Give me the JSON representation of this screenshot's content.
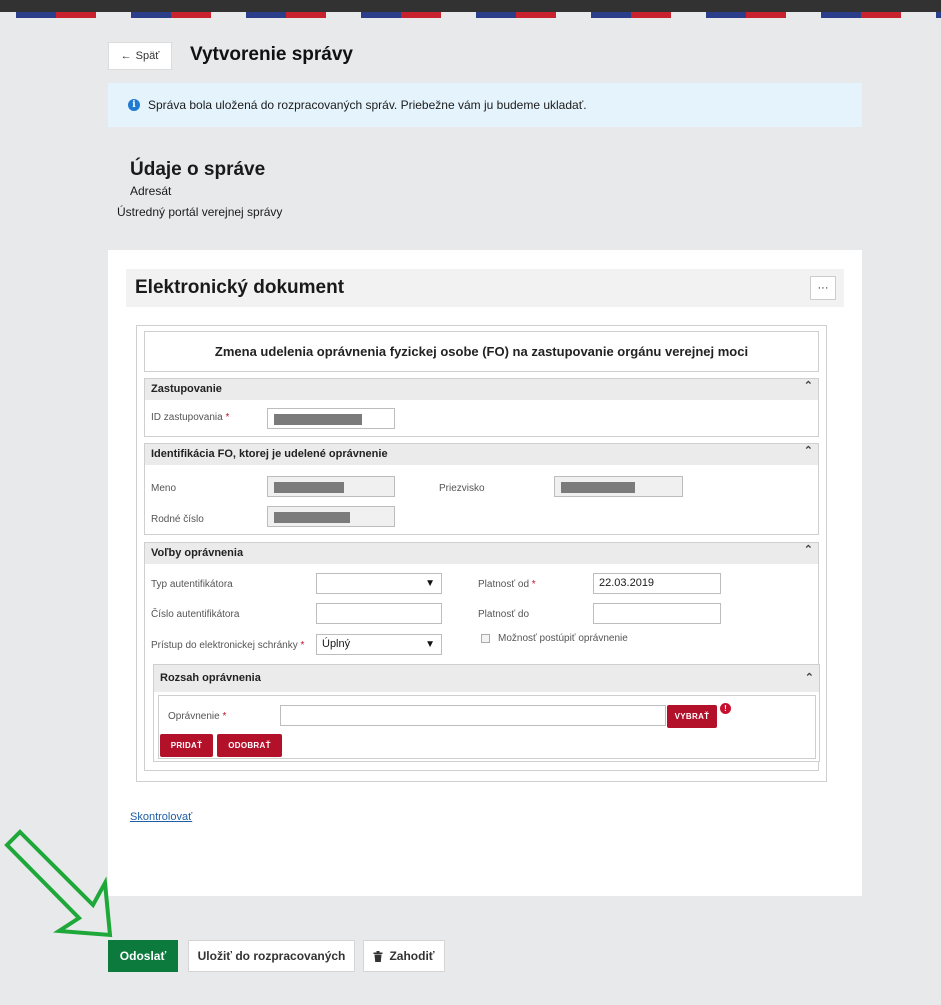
{
  "header": {
    "back_label": "Späť",
    "back_icon": "arrow-left-icon",
    "page_title": "Vytvorenie správy"
  },
  "notice": {
    "icon": "info-icon",
    "text": "Správa bola uložená do rozpracovaných správ. Priebežne vám ju budeme ukladať."
  },
  "message_info": {
    "title": "Údaje o správe",
    "recipient_label": "Adresát",
    "recipient_value": "Ústredný portál verejnej správy"
  },
  "document": {
    "title": "Elektronický dokument",
    "more_label": "···",
    "form_title": "Zmena udelenia oprávnenia fyzickej osobe (FO) na zastupovanie orgánu verejnej moci",
    "sections": {
      "representation": {
        "title": "Zastupovanie",
        "id_label": "ID zastupovania",
        "required_mark": "*"
      },
      "identification": {
        "title": "Identifikácia FO, ktorej je udelené oprávnenie",
        "first_name_label": "Meno",
        "last_name_label": "Priezvisko",
        "birth_number_label": "Rodné číslo"
      },
      "options": {
        "title": "Voľby oprávnenia",
        "auth_type_label": "Typ autentifikátora",
        "auth_number_label": "Číslo autentifikátora",
        "mailbox_access_label": "Prístup do elektronickej schránky",
        "mailbox_access_value": "Úplný",
        "valid_from_label": "Platnosť od",
        "valid_from_value": "22.03.2019",
        "valid_to_label": "Platnosť do",
        "delegate_label": "Možnosť postúpiť oprávnenie"
      },
      "scope": {
        "title": "Rozsah oprávnenia",
        "permission_label": "Oprávnenie",
        "select_label": "VYBRAŤ",
        "error_mark": "!",
        "add_label": "PRIDAŤ",
        "remove_label": "ODOBRAŤ"
      }
    },
    "check_link": "Skontrolovať"
  },
  "footer": {
    "send_label": "Odoslať",
    "save_draft_label": "Uložiť do rozpracovaných",
    "discard_label": "Zahodiť",
    "discard_icon": "trash-icon"
  },
  "colors": {
    "primary_green": "#0b7a3c",
    "danger_red": "#b3102a",
    "info_bg": "#e5f4fc",
    "annotation_arrow": "#1fa83a"
  }
}
